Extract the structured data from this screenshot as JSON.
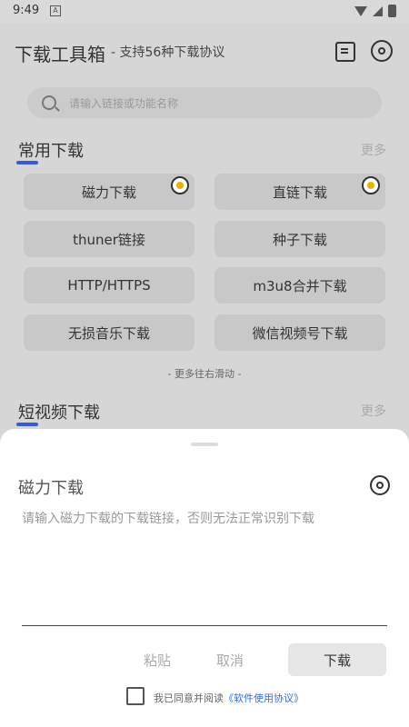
{
  "status_bar": {
    "time": "9:49",
    "a_icon": "A"
  },
  "header": {
    "title": "下载工具箱",
    "subtitle": "- 支持56种下载协议"
  },
  "search": {
    "placeholder": "请输入链接或功能名称"
  },
  "sections": [
    {
      "title": "常用下载",
      "more": "更多"
    },
    {
      "title": "短视频下载",
      "more": "更多"
    }
  ],
  "tools": [
    {
      "label": "磁力下载",
      "badge": true
    },
    {
      "label": "直链下载",
      "badge": true
    },
    {
      "label": "thuner链接"
    },
    {
      "label": "种子下载"
    },
    {
      "label": "HTTP/HTTPS"
    },
    {
      "label": "m3u8合并下载"
    },
    {
      "label": "无损音乐下载"
    },
    {
      "label": "微信视频号下载"
    }
  ],
  "scroll_hint": "- 更多往右滑动 -",
  "sheet": {
    "title": "磁力下载",
    "placeholder": "请输入磁力下载的下载链接，否则无法正常识别下载",
    "paste_label": "粘贴",
    "cancel_label": "取消",
    "download_label": "下载",
    "agree_text": "我已同意并阅读",
    "agree_link": "《软件使用协议》"
  },
  "colors": {
    "accent": "#3a5ad9",
    "link": "#3a6bd9",
    "badge": "#e6b400"
  }
}
